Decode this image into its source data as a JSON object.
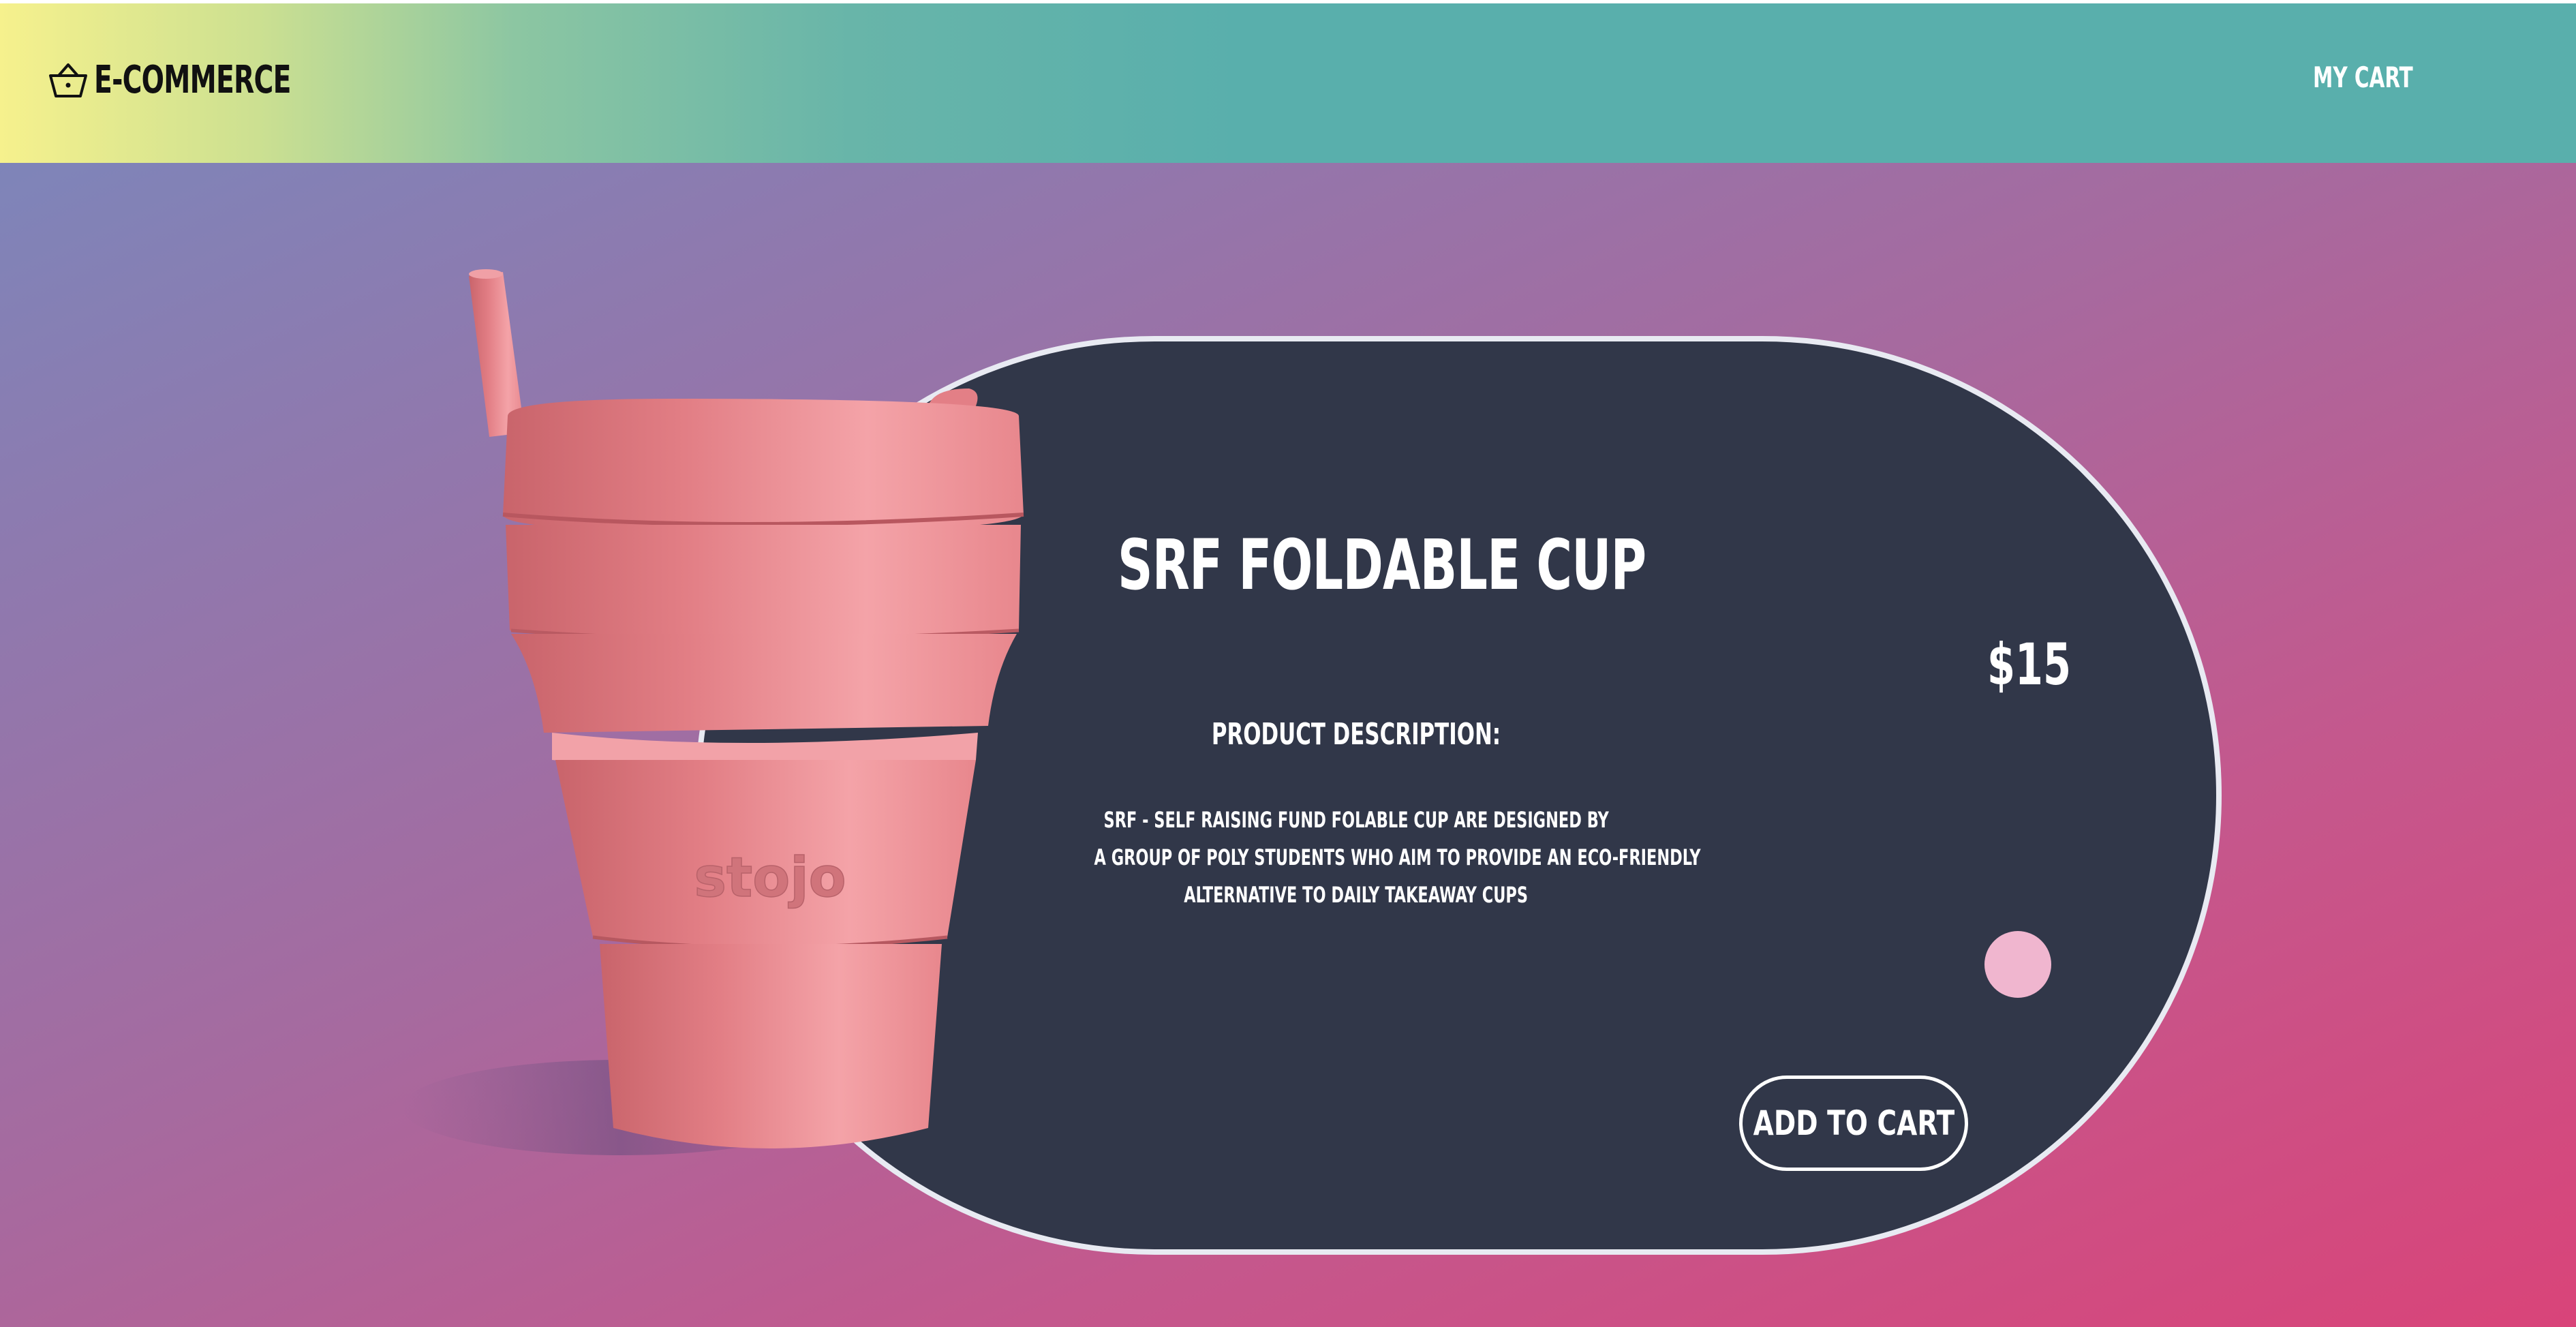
{
  "header": {
    "logo_text": "E-COMMERCE",
    "logo_icon": "basket-icon",
    "cart_label": "MY CART"
  },
  "product": {
    "name": "SRF FOLDABLE CUP",
    "price": "$15",
    "description_heading": "PRODUCT DESCRIPTION:",
    "description_lines": [
      "SRF - SELF RAISING FUND FOLABLE CUP ARE DESIGNED BY",
      "A GROUP OF POLY STUDENTS WHO AIM TO PROVIDE AN ECO-FRIENDLY",
      "ALTERNATIVE TO DAILY TAKEAWAY CUPS"
    ],
    "image_brand_text": "stojo",
    "color_option": "#f0b6cf",
    "add_to_cart_label": "ADD TO CART"
  },
  "colors": {
    "card_background": "#313749",
    "header_gradient_start": "#f6f18d",
    "header_gradient_end": "#59afac",
    "cup_pink": "#e47f86"
  }
}
